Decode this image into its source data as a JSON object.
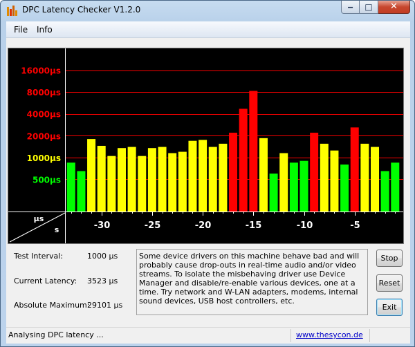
{
  "window": {
    "title": "DPC Latency Checker V1.2.0",
    "buttons": {
      "minimize": "‒",
      "maximize": "□",
      "close": "✕"
    }
  },
  "menu": {
    "items": [
      "File",
      "Info"
    ]
  },
  "chart_data": {
    "type": "bar",
    "y_tick_labels": [
      {
        "label": "16000µs",
        "color": "#ff0000"
      },
      {
        "label": "8000µs",
        "color": "#ff0000"
      },
      {
        "label": "4000µs",
        "color": "#ff0000"
      },
      {
        "label": "2000µs",
        "color": "#ff0000"
      },
      {
        "label": "1000µs",
        "color": "#ffff00"
      },
      {
        "label": "500µs",
        "color": "#00ff00"
      }
    ],
    "y_tick_values": [
      16000,
      8000,
      4000,
      2000,
      1000,
      500
    ],
    "y_scale": "log2",
    "ylim": [
      180,
      32000
    ],
    "axis_unit_label_y": "µs",
    "axis_unit_label_x": "s",
    "x_ticks": [
      -30,
      -25,
      -20,
      -15,
      -10,
      -5
    ],
    "x_tick_labels": [
      "-30",
      "-25",
      "-20",
      "-15",
      "-10",
      "-5"
    ],
    "xlim": [
      -33.6,
      -0.2
    ],
    "bar_width_seconds": 1,
    "grid": true,
    "thresholds": {
      "green_max": 1000,
      "yellow_max": 2000
    },
    "colors": {
      "green": "#00ff00",
      "yellow": "#ffff00",
      "red": "#ff0000",
      "background": "#000000",
      "grid": "#ff0000"
    },
    "x": [
      -33,
      -32,
      -31,
      -30,
      -29,
      -28,
      -27,
      -26,
      -25,
      -24,
      -23,
      -22,
      -21,
      -20,
      -19,
      -18,
      -17,
      -16,
      -15,
      -14,
      -13,
      -12,
      -11,
      -10,
      -9,
      -8,
      -7,
      -6,
      -5,
      -4,
      -3,
      -2,
      -1
    ],
    "values": [
      850,
      650,
      1800,
      1450,
      1050,
      1350,
      1400,
      1050,
      1350,
      1400,
      1150,
      1200,
      1700,
      1750,
      1400,
      1550,
      2200,
      4700,
      8300,
      1850,
      600,
      1150,
      850,
      900,
      2200,
      1550,
      1250,
      800,
      2600,
      1550,
      1400,
      650,
      850
    ]
  },
  "info": {
    "test_interval_label": "Test Interval:",
    "test_interval_value": "1000 µs",
    "current_latency_label": "Current Latency:",
    "current_latency_value": "3523 µs",
    "absolute_maximum_label": "Absolute Maximum:",
    "absolute_maximum_value": "29101 µs"
  },
  "message": "Some device drivers on this machine behave bad and will probably cause drop-outs in real-time audio and/or video streams. To isolate the misbehaving driver use Device Manager and disable/re-enable various devices, one at a time. Try network and W-LAN adapters, modems, internal sound devices, USB host controllers, etc.",
  "buttons": {
    "stop": "Stop",
    "reset": "Reset",
    "exit": "Exit"
  },
  "status": {
    "text": "Analysing DPC latency ...",
    "link": "www.thesycon.de"
  }
}
